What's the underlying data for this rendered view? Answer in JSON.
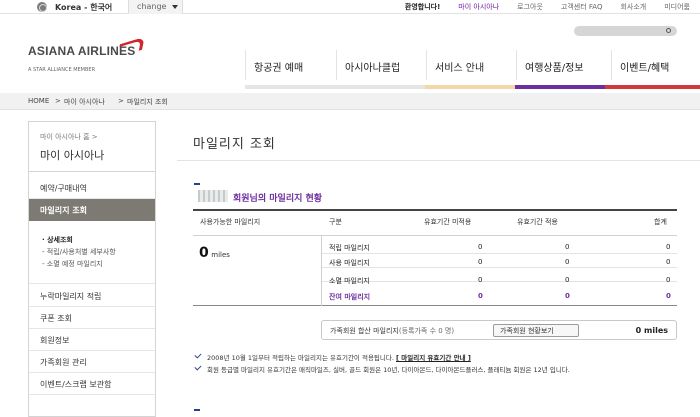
{
  "topbar": {
    "country": "Korea - 한국어",
    "change_label": "change",
    "links": [
      "환영합니다!",
      "마이 아시아나",
      "로그아웃",
      "고객센터 FAQ",
      "회사소개",
      "미디어룸"
    ]
  },
  "header": {
    "logo_text": "ASIANA AIRLINES",
    "logo_sub": "A STAR ALLIANCE MEMBER",
    "nav": [
      "항공권 예매",
      "아시아나클럽",
      "서비스 안내",
      "여행상품/정보",
      "이벤트/혜택"
    ],
    "accent_colors": [
      "#e5e5e5",
      "#f0d8a8",
      "#6d2fa0",
      "#d23a3a"
    ]
  },
  "breadcrumb": [
    "HOME",
    ">",
    "마이 아시아나",
    ">",
    "마일리지 조회"
  ],
  "sidebar": {
    "head_small": "마이 아시아나 홈 >",
    "head_big": "마이 아시아나",
    "items": [
      "예약/구매내역",
      "마일리지 조회",
      "누락마일리지 적립",
      "쿠폰 조회",
      "회원정보",
      "가족회원 관리",
      "이벤트/스크랩 보관함"
    ],
    "sub_items": [
      "· 상세조회",
      "- 적립/사용처별 세부사항",
      "- 소멸 예정 마일리지"
    ]
  },
  "main": {
    "title": "마일리지 조회",
    "section_title": "회원님의 마일리지 현황",
    "columns": [
      "사용가능한 마일리지",
      "구분",
      "유효기간 미적용",
      "유효기간 적용",
      "합계"
    ],
    "available_value": "0",
    "available_unit": "miles",
    "rows": [
      {
        "label": "적립 마일리지",
        "a": "0",
        "b": "0",
        "c": "0"
      },
      {
        "label": "사용 마일리지",
        "a": "0",
        "b": "0",
        "c": "0"
      },
      {
        "label": "소멸 마일리지",
        "a": "0",
        "b": "0",
        "c": "0"
      },
      {
        "label": "잔여 마일리지",
        "a": "0",
        "b": "0",
        "c": "0"
      }
    ],
    "family_label": "가족회원 합산 마일리지",
    "family_count": "(등록가족 수 0 명)",
    "family_button": "가족회원 현황보기",
    "family_value": "0 miles",
    "notes": [
      {
        "text": "2008년 10월 1일부터 적립하는 마일리지는 유효기간이 적용됩니다.",
        "link": "[ 마일리지 유효기간 안내 ]"
      },
      {
        "text": "회원 등급별 마일리지 유효기간은 매직마일즈, 실버, 골드 회원은 10년, 다이아몬드, 다이아몬드플러스, 플래티늄 회원은 12년 입니다.",
        "link": ""
      }
    ]
  }
}
